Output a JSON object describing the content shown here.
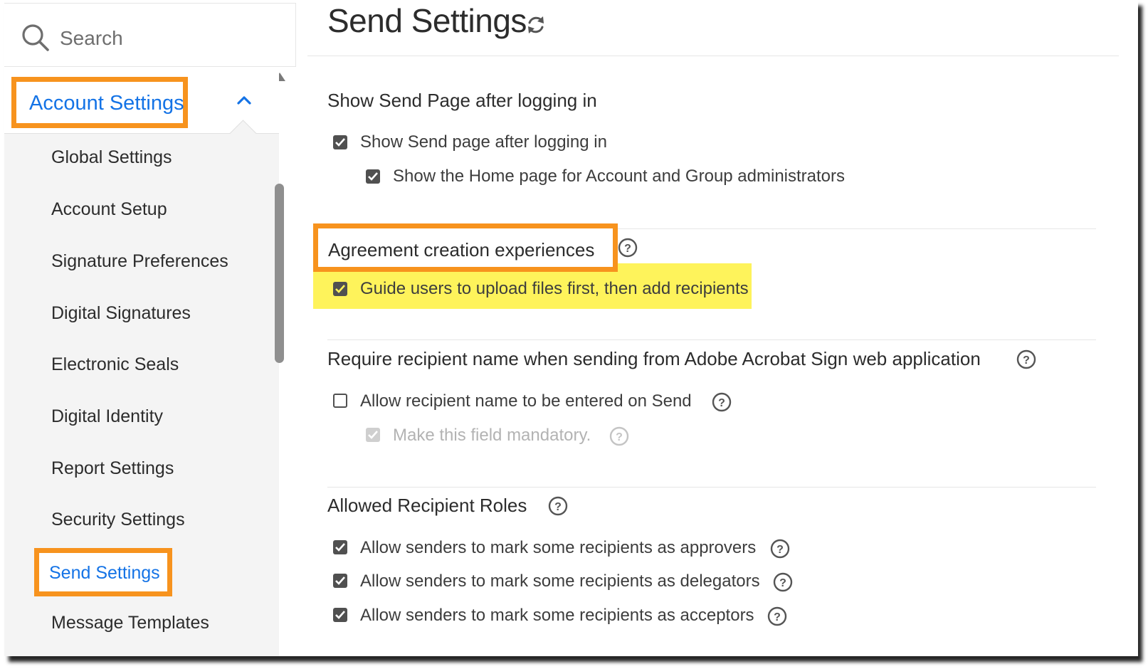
{
  "sidebar": {
    "search_placeholder": "Search",
    "section_title": "Account Settings",
    "items": [
      {
        "label": "Global Settings"
      },
      {
        "label": "Account Setup"
      },
      {
        "label": "Signature Preferences"
      },
      {
        "label": "Digital Signatures"
      },
      {
        "label": "Electronic Seals"
      },
      {
        "label": "Digital Identity"
      },
      {
        "label": "Report Settings"
      },
      {
        "label": "Security Settings"
      },
      {
        "label": "Send Settings",
        "active": true
      },
      {
        "label": "Message Templates"
      }
    ]
  },
  "main": {
    "title": "Send Settings",
    "sections": [
      {
        "heading": "Show Send Page after logging in",
        "options": [
          {
            "label": "Show Send page after logging in",
            "checked": true
          },
          {
            "label": "Show the Home page for Account and Group administrators",
            "checked": true
          }
        ]
      },
      {
        "heading": "Agreement creation experiences",
        "options": [
          {
            "label": "Guide users to upload files first, then add recipients",
            "checked": true
          }
        ]
      },
      {
        "heading": "Require recipient name when sending from Adobe Acrobat Sign web application",
        "options": [
          {
            "label": "Allow recipient name to be entered on Send",
            "checked": false
          },
          {
            "label": "Make this field mandatory.",
            "checked": true,
            "disabled": true
          }
        ]
      },
      {
        "heading": "Allowed Recipient Roles",
        "options": [
          {
            "label": "Allow senders to mark some recipients as approvers",
            "checked": true
          },
          {
            "label": "Allow senders to mark some recipients as delegators",
            "checked": true
          },
          {
            "label": "Allow senders to mark some recipients as acceptors",
            "checked": true
          }
        ]
      }
    ]
  },
  "colors": {
    "accent_blue": "#1473e6",
    "callout_orange": "#f7931e",
    "highlight_yellow": "#fef35b"
  }
}
